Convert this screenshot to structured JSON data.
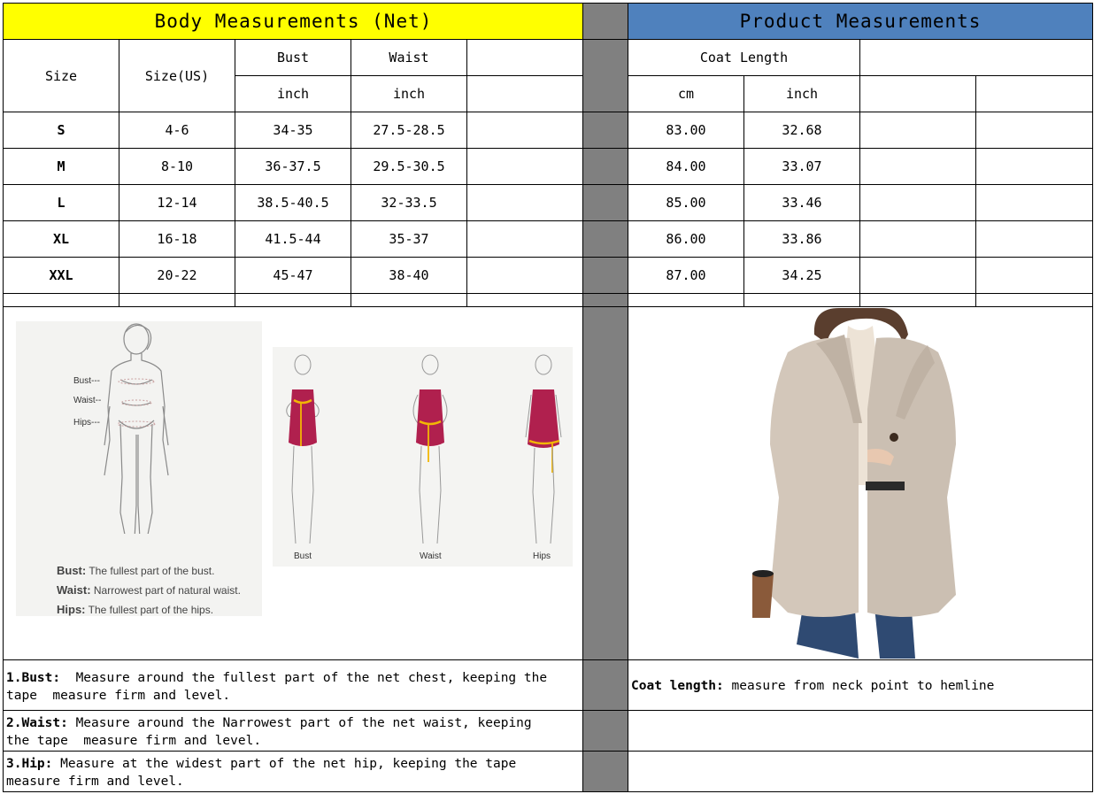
{
  "body_section": {
    "title": "Body Measurements (Net)",
    "col_size": "Size",
    "col_size_us": "Size(US)",
    "col_bust": "Bust",
    "col_waist": "Waist",
    "unit_bust": "inch",
    "unit_waist": "inch",
    "rows": [
      {
        "size": "S",
        "us": "4-6",
        "bust": "34-35",
        "waist": "27.5-28.5"
      },
      {
        "size": "M",
        "us": "8-10",
        "bust": "36-37.5",
        "waist": "29.5-30.5"
      },
      {
        "size": "L",
        "us": "12-14",
        "bust": "38.5-40.5",
        "waist": "32-33.5"
      },
      {
        "size": "XL",
        "us": "16-18",
        "bust": "41.5-44",
        "waist": "35-37"
      },
      {
        "size": "XXL",
        "us": "20-22",
        "bust": "45-47",
        "waist": "38-40"
      }
    ]
  },
  "product_section": {
    "title": "Product Measurements",
    "col_coat_length": "Coat Length",
    "unit_cm": "cm",
    "unit_inch": "inch",
    "rows": [
      {
        "cm": "83.00",
        "inch": "32.68"
      },
      {
        "cm": "84.00",
        "inch": "33.07"
      },
      {
        "cm": "85.00",
        "inch": "33.46"
      },
      {
        "cm": "86.00",
        "inch": "33.86"
      },
      {
        "cm": "87.00",
        "inch": "34.25"
      }
    ]
  },
  "figure_left": {
    "bust_tag": "Bust---",
    "waist_tag": "Waist--",
    "hips_tag": "Hips---",
    "bust_label": "Bust:",
    "bust_desc": "The fullest part of the bust.",
    "waist_label": "Waist:",
    "waist_desc": "Narrowest part of natural waist.",
    "hips_label": "Hips:",
    "hips_desc": "The fullest part of the hips."
  },
  "figure_right": {
    "bust": "Bust",
    "waist": "Waist",
    "hips": "Hips"
  },
  "notes": {
    "bust_key": "1.Bust:",
    "bust_text1": "  Measure around the fullest part of the net chest, keeping the",
    "bust_text2": "tape  measure firm and level.",
    "waist_key": "2.Waist:",
    "waist_text1": " Measure around the Narrowest part of the net waist, keeping",
    "waist_text2": "the tape  measure firm and level.",
    "hip_key": "3.Hip:",
    "hip_text1": " Measure at the widest part of the net hip, keeping the tape",
    "hip_text2": "measure firm and level.",
    "coat_key": "Coat length:",
    "coat_text": " measure from neck point to hemline"
  },
  "colors": {
    "header_left": "#FFFF00",
    "header_right": "#4F81BD",
    "divider": "#808080",
    "dress": "#B0204E",
    "tape": "#F2B705",
    "coat": "#D3C7BA"
  }
}
